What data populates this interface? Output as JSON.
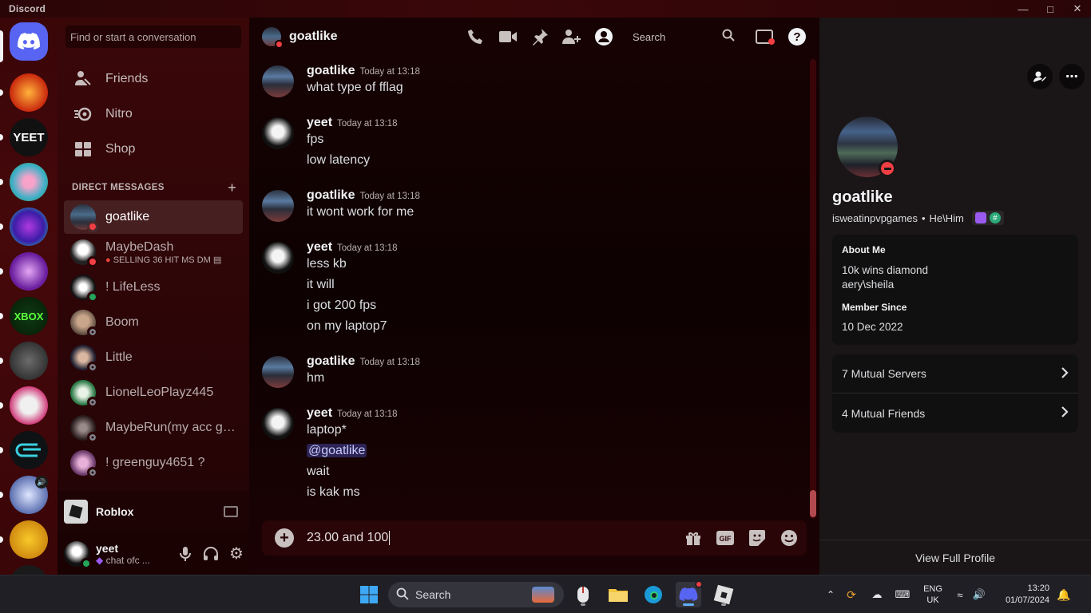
{
  "window": {
    "app_name": "Discord"
  },
  "sidebar": {
    "search_placeholder": "Find or start a conversation",
    "nav": [
      {
        "label": "Friends",
        "icon": "friends-icon"
      },
      {
        "label": "Nitro",
        "icon": "nitro-icon"
      },
      {
        "label": "Shop",
        "icon": "shop-icon"
      }
    ],
    "dm_header": "DIRECT MESSAGES",
    "dms": [
      {
        "name": "goatlike",
        "status": "dnd",
        "active": true
      },
      {
        "name": "MaybeDash",
        "sub": "SELLING 36 HIT MS DM",
        "status": "dnd"
      },
      {
        "name": "! LifeLess",
        "status": "online"
      },
      {
        "name": "Boom",
        "status": "offline"
      },
      {
        "name": "Little",
        "status": "offline"
      },
      {
        "name": "LionelLeoPlayz445",
        "status": "offline"
      },
      {
        "name": "MaybeRun(my acc got...",
        "status": "offline"
      },
      {
        "name": "! greenguy4651 ?",
        "status": "offline"
      }
    ],
    "activity": {
      "name": "Roblox"
    },
    "user": {
      "name": "yeet",
      "status_text": "chat ofc ..."
    }
  },
  "chat": {
    "channel_name": "goatlike",
    "search_label": "Search",
    "messages": [
      {
        "author": "goatlike",
        "time": "Today at 13:18",
        "lines": [
          "what type of fflag"
        ]
      },
      {
        "author": "yeet",
        "time": "Today at 13:18",
        "lines": [
          "fps",
          "low latency"
        ]
      },
      {
        "author": "goatlike",
        "time": "Today at 13:18",
        "lines": [
          "it wont work for me"
        ]
      },
      {
        "author": "yeet",
        "time": "Today at 13:18",
        "lines": [
          "less kb",
          "it will",
          "i got 200 fps",
          "on my laptop7"
        ]
      },
      {
        "author": "goatlike",
        "time": "Today at 13:18",
        "lines": [
          "hm"
        ]
      },
      {
        "author": "yeet",
        "time": "Today at 13:18",
        "lines": [
          "laptop*",
          "@goatlike",
          "wait",
          "is kak ms"
        ]
      }
    ],
    "composer_text": "23.00 and 100"
  },
  "profile": {
    "name": "goatlike",
    "username": "isweatinpvpgames",
    "pronouns": "He\\Him",
    "about_label": "About Me",
    "about_lines": [
      "10k wins diamond",
      "aery\\sheila"
    ],
    "member_since_label": "Member Since",
    "member_since": "10 Dec 2022",
    "mutual_servers": "7 Mutual Servers",
    "mutual_friends": "4 Mutual Friends",
    "view_full": "View Full Profile"
  },
  "taskbar": {
    "search_label": "Search",
    "lang": "ENG",
    "region": "UK",
    "time": "13:20",
    "date": "01/07/2024"
  },
  "colors": {
    "blurple": "#5865f2",
    "dnd": "#f23f43",
    "online": "#23a55a"
  }
}
